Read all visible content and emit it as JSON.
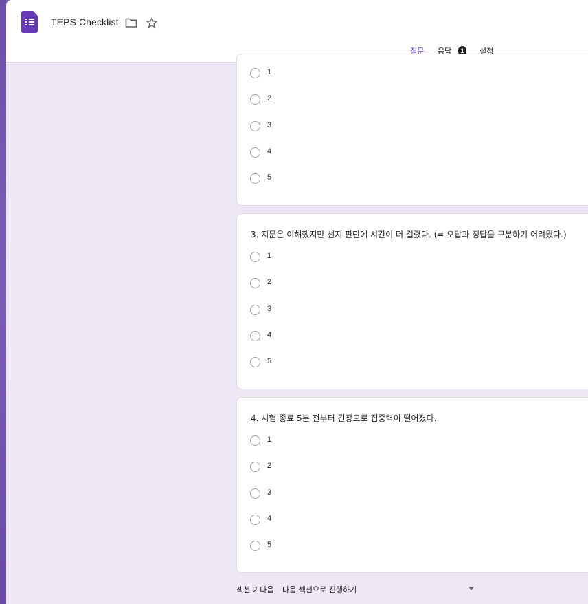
{
  "header": {
    "title": "TEPS Checklist",
    "folder_icon": "folder-icon",
    "star_icon": "star-icon",
    "accent_color": "#673ab7"
  },
  "tabs": {
    "questions": "질문",
    "responses": "응답",
    "responses_badge": "1",
    "settings": "설정"
  },
  "questions": [
    {
      "title": "",
      "options": [
        "1",
        "2",
        "3",
        "4",
        "5"
      ]
    },
    {
      "title": "3. 지문은 이해했지만 선지 판단에 시간이 더 걸렸다. (= 오답과 정답을 구분하기 어려웠다.)",
      "options": [
        "1",
        "2",
        "3",
        "4",
        "5"
      ]
    },
    {
      "title": "4. 시험 종료 5분 전부터 긴장으로 집중력이 떨어졌다.",
      "options": [
        "1",
        "2",
        "3",
        "4",
        "5"
      ]
    }
  ],
  "footer": {
    "after_section_label": "섹션 2 다음",
    "selected_value": "다음 섹션으로 진행하기"
  }
}
